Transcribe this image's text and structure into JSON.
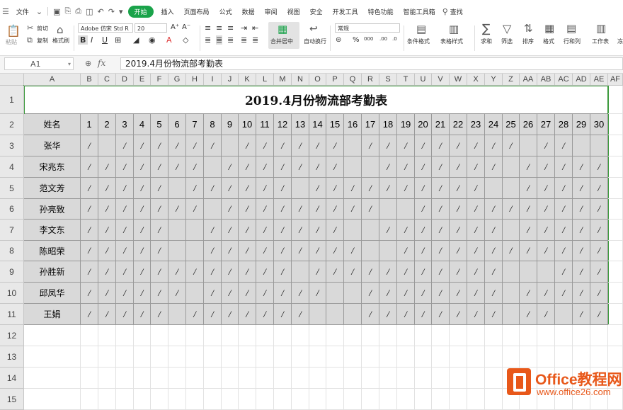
{
  "menu": {
    "file": "文件",
    "tabs": [
      "开始",
      "插入",
      "页面布局",
      "公式",
      "数据",
      "审阅",
      "视图",
      "安全",
      "开发工具",
      "特色功能",
      "智能工具箱"
    ],
    "search": "查找"
  },
  "ribbon": {
    "paste": "粘贴",
    "cut": "剪切",
    "copy": "复制",
    "format_painter": "格式刷",
    "font_name": "Adobe 仿宋 Std R",
    "font_size": "20",
    "merge_center": "合并居中",
    "wrap": "自动换行",
    "number_format": "常规",
    "cond_format": "条件格式",
    "table_style": "表格样式",
    "sum": "求和",
    "filter": "筛选",
    "sort": "排序",
    "format": "格式",
    "rows_cols": "行和列",
    "worksheet": "工作表",
    "more": "冻"
  },
  "formula_bar": {
    "cell_ref": "A1",
    "fx": "fx",
    "content": "2019.4月份物流部考勤表"
  },
  "sheet": {
    "columns": [
      "A",
      "B",
      "C",
      "D",
      "E",
      "F",
      "G",
      "H",
      "I",
      "J",
      "K",
      "L",
      "M",
      "N",
      "O",
      "P",
      "Q",
      "R",
      "S",
      "T",
      "U",
      "V",
      "W",
      "X",
      "Y",
      "Z",
      "AA",
      "AB",
      "AC",
      "AD",
      "AE",
      "AF"
    ],
    "rows": [
      "1",
      "2",
      "3",
      "4",
      "5",
      "6",
      "7",
      "8",
      "9",
      "10",
      "11",
      "12",
      "13",
      "14",
      "15"
    ],
    "title": "2019.4月份物流部考勤表",
    "header_name": "姓名",
    "days": [
      "1",
      "2",
      "3",
      "4",
      "5",
      "6",
      "7",
      "8",
      "9",
      "10",
      "11",
      "12",
      "13",
      "14",
      "15",
      "16",
      "17",
      "18",
      "19",
      "20",
      "21",
      "22",
      "23",
      "24",
      "25",
      "26",
      "27",
      "28",
      "29",
      "30"
    ],
    "mark": "/",
    "employees": [
      {
        "name": "张华",
        "days": "1011111101111110111111111011"
      },
      {
        "name": "宋兆东",
        "days": "111111101111111001111111011111"
      },
      {
        "name": "范文芳",
        "days": "111110111111011111111110011111"
      },
      {
        "name": "孙亮致",
        "days": "111111101111111110011111111111"
      },
      {
        "name": "李文东",
        "days": "111110011111111001111111011111"
      },
      {
        "name": "陈昭荣",
        "days": "111110011111111100111111111111"
      },
      {
        "name": "孙胜新",
        "days": "111111111111011111111111000111"
      },
      {
        "name": "邱凤华",
        "days": "111111011111110011111111011111"
      },
      {
        "name": "王娟",
        "days": "111110111111100011111111011011"
      }
    ]
  },
  "watermark": {
    "brand": "Office教程网",
    "url": "www.office26.com"
  },
  "colors": {
    "accent": "#1aa34a",
    "selection": "#3d9a3d",
    "filled": "#d9d9d9",
    "watermark": "#e8581a"
  }
}
